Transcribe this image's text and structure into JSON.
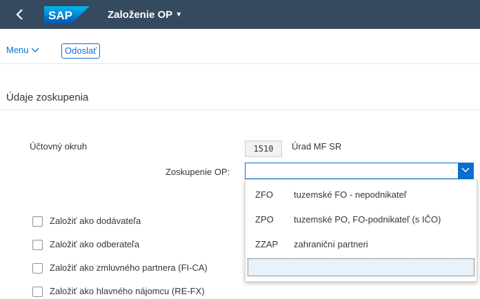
{
  "shell": {
    "back_icon": "chevron-left-icon",
    "logo_text": "SAP",
    "app_title": "Založenie OP",
    "title_caret": "▼"
  },
  "toolbar": {
    "menu_label": "Menu",
    "send_label": "Odoslať"
  },
  "section": {
    "title": "Údaje zoskupenia"
  },
  "form": {
    "okruh_label": "Účtovný okruh",
    "okruh_value": "1510",
    "okruh_text": "Úrad MF SR",
    "zoskupenie_label": "Zoskupenie OP:",
    "zoskupenie_value": ""
  },
  "dropdown": {
    "options": [
      {
        "code": "ZFO",
        "text": "tuzemské FO - nepodnikateľ"
      },
      {
        "code": "ZPO",
        "text": "tuzemské PO, FO-podnikateľ (s IČO)"
      },
      {
        "code": "ZZAP",
        "text": "zahraniční partneri"
      }
    ]
  },
  "checkboxes": [
    {
      "label": "Založiť ako dodávateľa",
      "checked": false
    },
    {
      "label": "Založiť ako odberateľa",
      "checked": false
    },
    {
      "label": "Založiť ako zmluvného partnera (FI-CA)",
      "checked": false
    },
    {
      "label": "Založiť ako hlavného nájomcu (RE-FX)",
      "checked": false
    }
  ],
  "colors": {
    "shell_bg": "#354a5f",
    "accent": "#0a6ed1",
    "sap_logo_gradient": [
      "#00b8f1",
      "#0057b8"
    ]
  }
}
